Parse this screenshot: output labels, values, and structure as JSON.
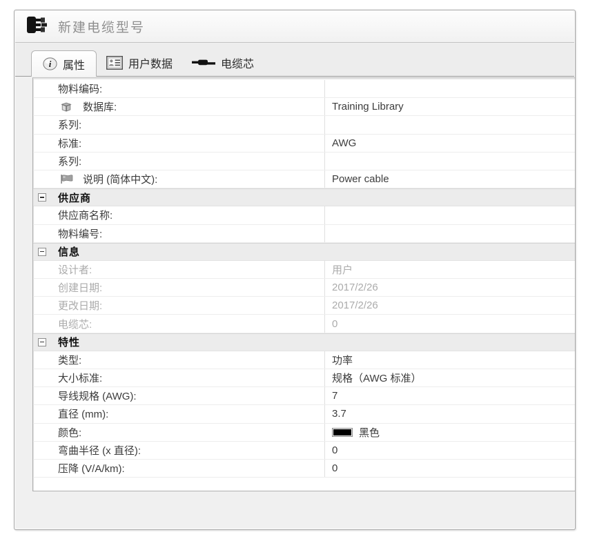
{
  "window": {
    "title": "新建电缆型号",
    "title_icon": "cable-plug-icon"
  },
  "tabs": [
    {
      "id": "properties",
      "label": "属性",
      "icon": "info-icon",
      "active": true
    },
    {
      "id": "user-data",
      "label": "用户数据",
      "icon": "user-data-icon",
      "active": false
    },
    {
      "id": "cable-cores",
      "label": "电缆芯",
      "icon": "cable-core-icon",
      "active": false
    }
  ],
  "property_grid": {
    "rows": [
      {
        "type": "field",
        "label": "物料编码:",
        "value": ""
      },
      {
        "type": "field",
        "label": "数据库:",
        "icon": "library-box-icon",
        "value": "Training Library"
      },
      {
        "type": "field",
        "label": "系列:",
        "value": ""
      },
      {
        "type": "field",
        "label": "标准:",
        "value": "AWG"
      },
      {
        "type": "field",
        "label": "系列:",
        "value": ""
      },
      {
        "type": "field",
        "label": "说明 (简体中文):",
        "icon": "language-flag-icon",
        "value": "Power cable"
      },
      {
        "type": "group",
        "label": "供应商"
      },
      {
        "type": "field",
        "label": "供应商名称:",
        "value": ""
      },
      {
        "type": "field",
        "label": "物料编号:",
        "value": ""
      },
      {
        "type": "group",
        "label": "信息"
      },
      {
        "type": "field",
        "label": "设计者:",
        "value": "用户",
        "disabled": true
      },
      {
        "type": "field",
        "label": "创建日期:",
        "value": "2017/2/26",
        "disabled": true
      },
      {
        "type": "field",
        "label": "更改日期:",
        "value": "2017/2/26",
        "disabled": true
      },
      {
        "type": "field",
        "label": "电缆芯:",
        "value": "0",
        "disabled": true
      },
      {
        "type": "group",
        "label": "特性"
      },
      {
        "type": "field",
        "label": "类型:",
        "value": "功率"
      },
      {
        "type": "field",
        "label": "大小标准:",
        "value": "规格（AWG 标准）"
      },
      {
        "type": "field",
        "label": "导线规格 (AWG):",
        "value": "7"
      },
      {
        "type": "field",
        "label": "直径 (mm):",
        "value": "3.7"
      },
      {
        "type": "field",
        "label": "颜色:",
        "value": "黑色",
        "swatch": "#000000"
      },
      {
        "type": "field",
        "label": "弯曲半径 (x 直径):",
        "value": "0"
      },
      {
        "type": "field",
        "label": "压降 (V/A/km):",
        "value": "0"
      }
    ]
  },
  "colors": {
    "window_background": "#f0f0f0",
    "grid_background": "#ffffff",
    "group_row_background": "#ececec",
    "disabled_text": "#ababab",
    "title_text": "#8f8f8f",
    "black_swatch": "#000000"
  }
}
